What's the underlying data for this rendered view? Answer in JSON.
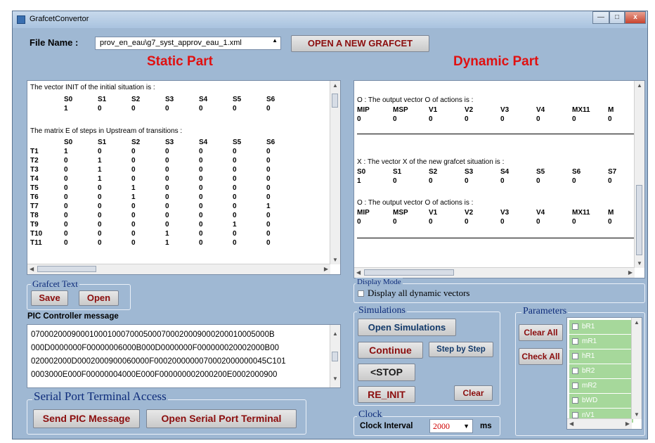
{
  "window": {
    "title": "GrafcetConvertor",
    "buttons": {
      "minimize": "—",
      "maximize": "□",
      "close": "x"
    }
  },
  "file": {
    "label": "File Name :",
    "value": "prov_en_eau\\g7_syst_approv_eau_1.xml",
    "open_button": "OPEN A NEW GRAFCET"
  },
  "static": {
    "title": "Static Part",
    "init_heading": "The vector INIT of the initial situation is :",
    "init_cols": [
      "S0",
      "S1",
      "S2",
      "S3",
      "S4",
      "S5",
      "S6"
    ],
    "init_vals": [
      "1",
      "0",
      "0",
      "0",
      "0",
      "0",
      "0"
    ],
    "matrix_heading": "The matrix E of steps in Upstream of transitions :",
    "matrix_cols": [
      "S0",
      "S1",
      "S2",
      "S3",
      "S4",
      "S5",
      "S6"
    ],
    "matrix_rows": [
      {
        "label": "T1",
        "vals": [
          "1",
          "0",
          "0",
          "0",
          "0",
          "0",
          "0"
        ]
      },
      {
        "label": "T2",
        "vals": [
          "0",
          "1",
          "0",
          "0",
          "0",
          "0",
          "0"
        ]
      },
      {
        "label": "T3",
        "vals": [
          "0",
          "1",
          "0",
          "0",
          "0",
          "0",
          "0"
        ]
      },
      {
        "label": "T4",
        "vals": [
          "0",
          "1",
          "0",
          "0",
          "0",
          "0",
          "0"
        ]
      },
      {
        "label": "T5",
        "vals": [
          "0",
          "0",
          "1",
          "0",
          "0",
          "0",
          "0"
        ]
      },
      {
        "label": "T6",
        "vals": [
          "0",
          "0",
          "1",
          "0",
          "0",
          "0",
          "0"
        ]
      },
      {
        "label": "T7",
        "vals": [
          "0",
          "0",
          "0",
          "0",
          "0",
          "0",
          "1"
        ]
      },
      {
        "label": "T8",
        "vals": [
          "0",
          "0",
          "0",
          "0",
          "0",
          "0",
          "0"
        ]
      },
      {
        "label": "T9",
        "vals": [
          "0",
          "0",
          "0",
          "0",
          "0",
          "1",
          "0"
        ]
      },
      {
        "label": "T10",
        "vals": [
          "0",
          "0",
          "0",
          "1",
          "0",
          "0",
          "0"
        ]
      },
      {
        "label": "T11",
        "vals": [
          "0",
          "0",
          "0",
          "1",
          "0",
          "0",
          "0"
        ]
      }
    ]
  },
  "dynamic": {
    "title": "Dynamic Part",
    "o_heading_1": "O : The output vector O of actions is :",
    "x_heading": "X : The vector X of the new grafcet situation is :",
    "o_heading_2": "O : The output vector O of actions is :",
    "o_cols": [
      "MIP",
      "MSP",
      "V1",
      "V2",
      "V3",
      "V4",
      "MX11",
      "M"
    ],
    "o_vals_1": [
      "0",
      "0",
      "0",
      "0",
      "0",
      "0",
      "0",
      "0"
    ],
    "x_cols": [
      "S0",
      "S1",
      "S2",
      "S3",
      "S4",
      "S5",
      "S6",
      "S7"
    ],
    "x_vals": [
      "1",
      "0",
      "0",
      "0",
      "0",
      "0",
      "0",
      "0"
    ],
    "o_vals_2": [
      "0",
      "0",
      "0",
      "0",
      "0",
      "0",
      "0",
      "0"
    ]
  },
  "grafcet_text": {
    "title": "Grafcet Text",
    "save": "Save",
    "open": "Open"
  },
  "pic": {
    "label": "PIC Controller message",
    "lines": [
      "07000200090001000100070005000700020009000200010005000B",
      "000D0000000F00000006000B000D0000000F000000020002000B00",
      "020002000D0002000900060000F0002000000070002000000045C101",
      "0003000E000F00000004000E000F000000002000200E0002000900"
    ]
  },
  "serial": {
    "title": "Serial Port Terminal Access",
    "send": "Send PIC Message",
    "open_terminal": "Open Serial Port Terminal"
  },
  "display_mode": {
    "title": "Display Mode",
    "checkbox": "Display all dynamic vectors"
  },
  "simulations": {
    "title": "Simulations",
    "open": "Open Simulations",
    "continue": "Continue",
    "step": "Step by Step",
    "stop": "<STOP",
    "reinit": "RE_INIT",
    "clear": "Clear"
  },
  "clock": {
    "title": "Clock",
    "label": "Clock Interval",
    "value": "2000",
    "unit": "ms"
  },
  "parameters": {
    "title": "Parameters",
    "clear_all": "Clear All",
    "check_all": "Check All",
    "items": [
      "bR1",
      "mR1",
      "hR1",
      "bR2",
      "mR2",
      "bWD",
      "nV1"
    ]
  }
}
